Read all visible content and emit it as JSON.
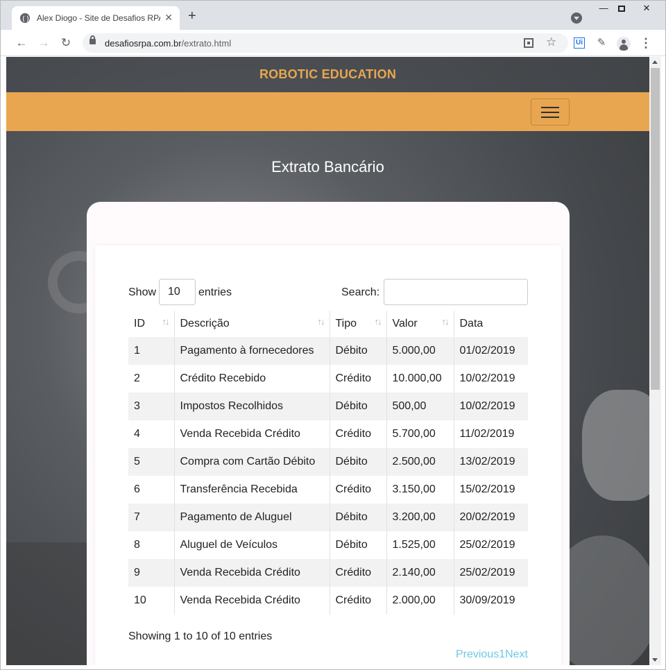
{
  "browser": {
    "tab_title": "Alex Diogo - Site de Desafios RPA",
    "tab_close": "✕",
    "new_tab": "+",
    "url_host": "desafiosrpa.com.br",
    "url_path": "/extrato.html",
    "ext_label": "Ui",
    "icons": [
      "globe-icon",
      "close-icon",
      "plus-icon",
      "back-arrow-icon",
      "forward-arrow-icon",
      "reload-icon",
      "lock-icon",
      "qr-code-icon",
      "star-icon",
      "puzzle-icon",
      "avatar-icon",
      "kebab-menu-icon"
    ]
  },
  "header": {
    "brand": "ROBOTIC EDUCATION",
    "brand_color": "#e8a650"
  },
  "page": {
    "title": "Extrato Bancário"
  },
  "table_controls": {
    "show_label": "Show",
    "page_length": "10",
    "entries_label": "entries",
    "search_label": "Search:",
    "search_value": ""
  },
  "table": {
    "columns": [
      "ID",
      "Descrição",
      "Tipo",
      "Valor",
      "Data"
    ],
    "rows": [
      [
        "1",
        "Pagamento à fornecedores",
        "Débito",
        "5.000,00",
        "01/02/2019"
      ],
      [
        "2",
        "Crédito Recebido",
        "Crédito",
        "10.000,00",
        "10/02/2019"
      ],
      [
        "3",
        "Impostos Recolhidos",
        "Débito",
        "500,00",
        "10/02/2019"
      ],
      [
        "4",
        "Venda Recebida Crédito",
        "Crédito",
        "5.700,00",
        "11/02/2019"
      ],
      [
        "5",
        "Compra com Cartão Débito",
        "Débito",
        "2.500,00",
        "13/02/2019"
      ],
      [
        "6",
        "Transferência Recebida",
        "Crédito",
        "3.150,00",
        "15/02/2019"
      ],
      [
        "7",
        "Pagamento de Aluguel",
        "Débito",
        "3.200,00",
        "20/02/2019"
      ],
      [
        "8",
        "Aluguel de Veículos",
        "Débito",
        "1.525,00",
        "25/02/2019"
      ],
      [
        "9",
        "Venda Recebida Crédito",
        "Crédito",
        "2.140,00",
        "25/02/2019"
      ],
      [
        "10",
        "Venda Recebida Crédito",
        "Crédito",
        "2.000,00",
        "30/09/2019"
      ]
    ]
  },
  "footer": {
    "info": "Showing 1 to 10 of 10 entries",
    "previous": "Previous",
    "page": "1",
    "next": "Next",
    "link_color": "#6ec9e6"
  }
}
